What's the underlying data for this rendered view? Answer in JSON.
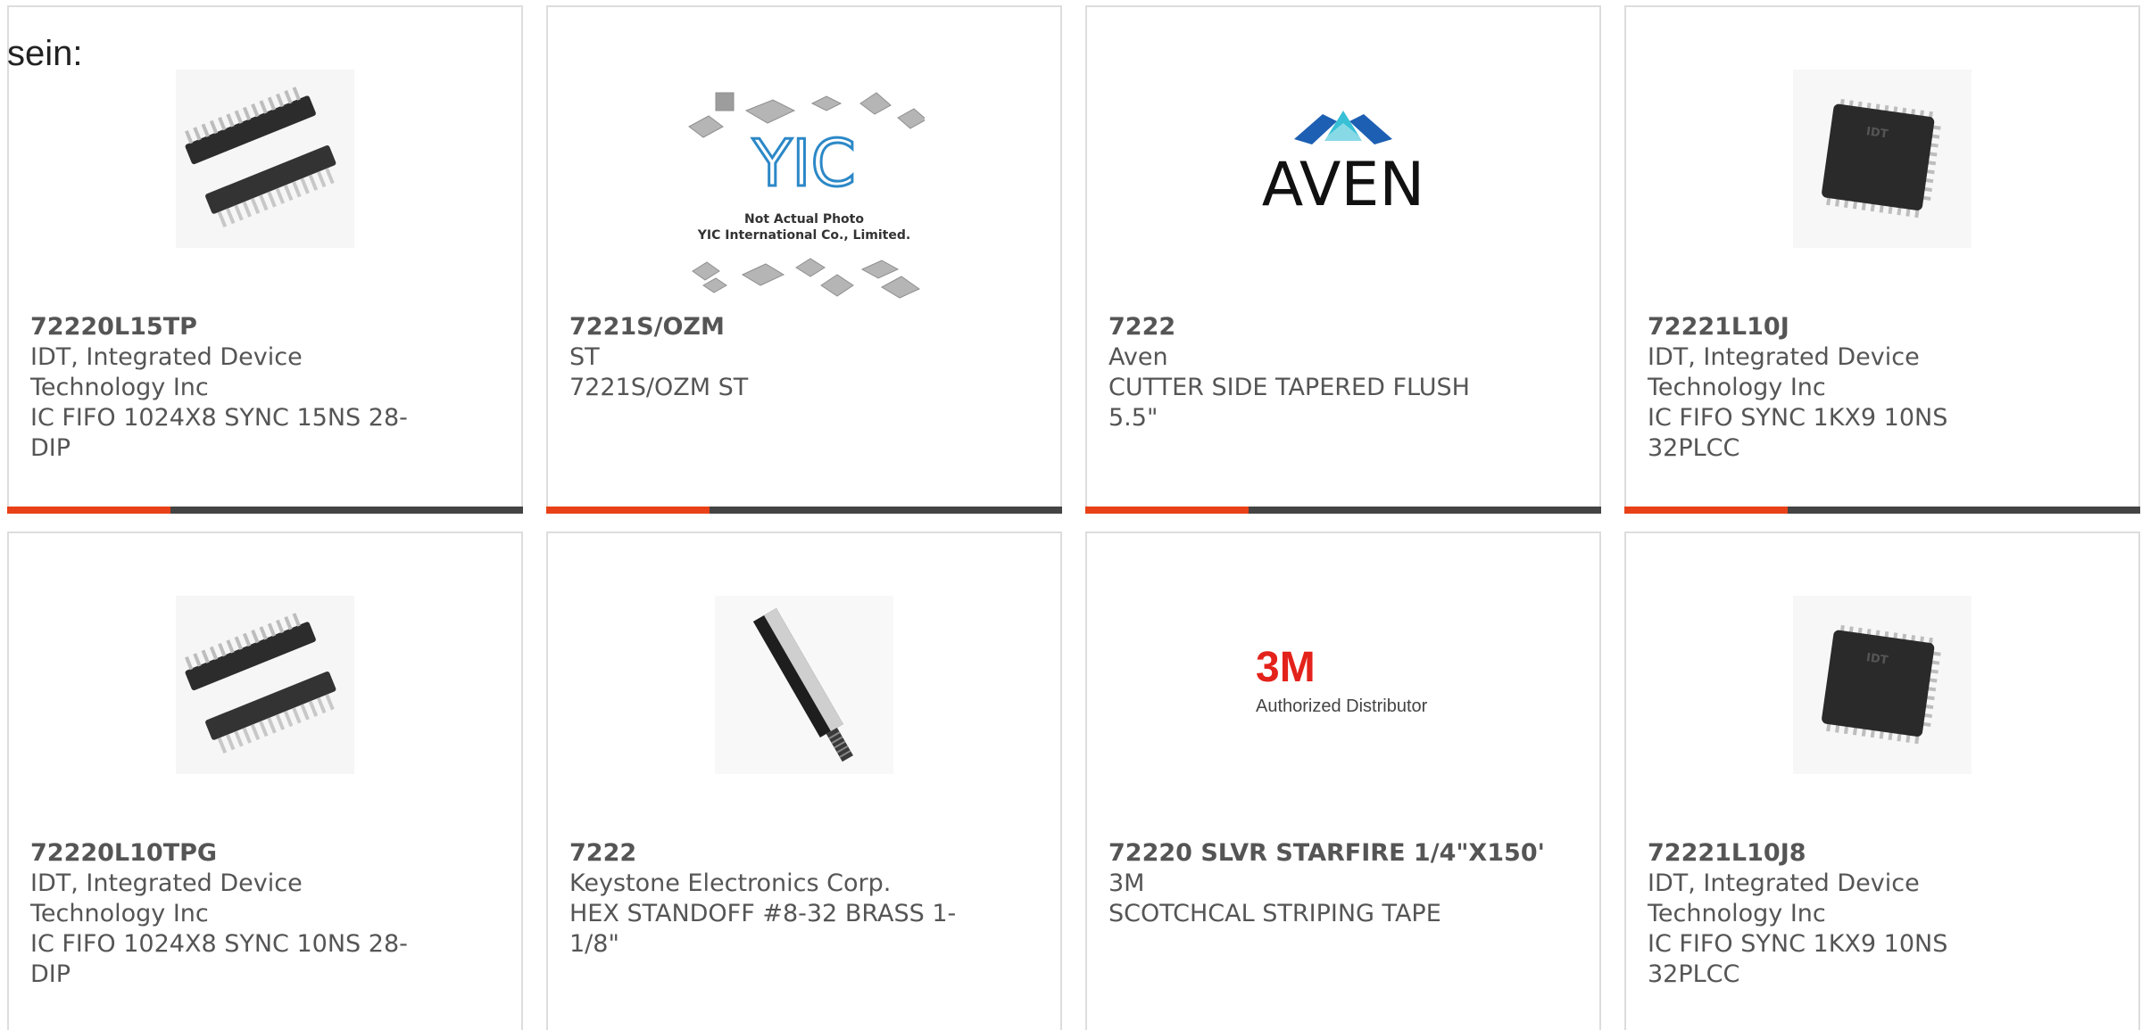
{
  "intro_text": "sein:",
  "products": [
    {
      "part_number": "72220L15TP",
      "manufacturer": "IDT, Integrated Device Technology Inc",
      "description": "IC FIFO 1024X8 SYNC 15NS 28-DIP",
      "image": "dip-chip-icon"
    },
    {
      "part_number": "7221S/OZM",
      "manufacturer": "ST",
      "description": "7221S/OZM ST",
      "image": "not-actual-photo",
      "image_text_logo": "YIC",
      "image_text_line1": "Not Actual Photo",
      "image_text_line2": "YIC International Co., Limited."
    },
    {
      "part_number": "7222",
      "manufacturer": "Aven",
      "description": "CUTTER SIDE TAPERED FLUSH 5.5\"",
      "image": "aven-logo",
      "image_text_logo": "AVEN"
    },
    {
      "part_number": "72221L10J",
      "manufacturer": "IDT, Integrated Device Technology Inc",
      "description": "IC FIFO SYNC 1KX9 10NS 32PLCC",
      "image": "plcc-chip-icon",
      "image_text_logo": "IDT"
    },
    {
      "part_number": "72220L10TPG",
      "manufacturer": "IDT, Integrated Device Technology Inc",
      "description": "IC FIFO 1024X8 SYNC 10NS 28-DIP",
      "image": "dip-chip-icon"
    },
    {
      "part_number": "7222",
      "manufacturer": "Keystone Electronics Corp.",
      "description": "HEX STANDOFF #8-32 BRASS 1-1/8\"",
      "image": "standoff-icon"
    },
    {
      "part_number": "72220 SLVR STARFIRE 1/4\"X150'",
      "manufacturer": "3M",
      "description": "SCOTCHCAL STRIPING TAPE",
      "image": "3m-logo",
      "image_text_logo": "3M",
      "image_text_line1": "Authorized Distributor"
    },
    {
      "part_number": "72221L10J8",
      "manufacturer": "IDT, Integrated Device Technology Inc",
      "description": "IC FIFO SYNC 1KX9 10NS 32PLCC",
      "image": "plcc-chip-icon",
      "image_text_logo": "IDT"
    }
  ],
  "colors": {
    "accent": "#e84117",
    "bar": "#444444",
    "text": "#555555",
    "border": "#dddddd"
  }
}
